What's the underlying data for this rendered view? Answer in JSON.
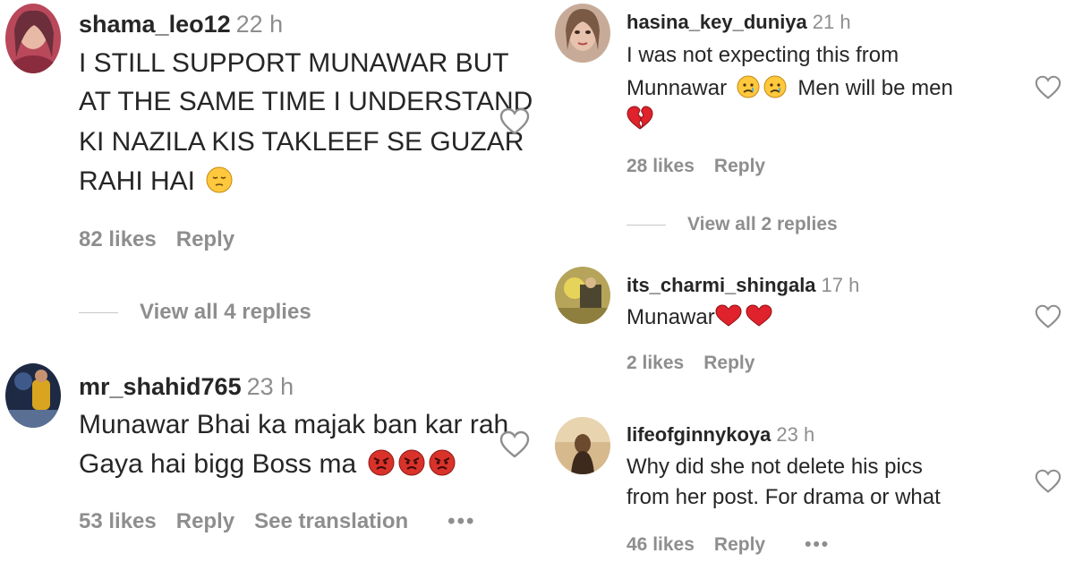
{
  "colors": {
    "text": "#262626",
    "muted": "#8e8e8e",
    "heart_red": "#ed1c24",
    "emoji_yellow": "#ffc83d",
    "emoji_angry": "#d8322a"
  },
  "left_comments": [
    {
      "username": "shama_leo12",
      "time": "22 h",
      "lines": [
        "I STILL SUPPORT MUNAWAR BUT",
        "AT THE SAME TIME I UNDERSTAND",
        "KI NAZILA KIS TAKLEEF SE GUZAR",
        "RAHI HAI"
      ],
      "trailing_emoji": [
        "pensive-face-icon"
      ],
      "likes": "82 likes",
      "reply_label": "Reply",
      "view_replies": "View all 4 replies"
    },
    {
      "username": "mr_shahid765",
      "time": "23 h",
      "lines": [
        "Munawar Bhai ka majak ban kar rah",
        "Gaya hai bigg Boss ma"
      ],
      "trailing_emoji": [
        "angry-face-icon",
        "angry-face-icon",
        "angry-face-icon"
      ],
      "likes": "53 likes",
      "reply_label": "Reply",
      "translation_label": "See translation",
      "more_label": "•••"
    }
  ],
  "right_comments": [
    {
      "username": "hasina_key_duniya",
      "time": "21 h",
      "lines": [
        "I was not expecting this from",
        "Munnawar",
        "Men will be men"
      ],
      "line_emoji": [
        "crying-face-icon",
        "crying-face-icon"
      ],
      "third_line_emoji": "broken-heart-icon",
      "likes": "28 likes",
      "reply_label": "Reply",
      "view_replies": "View all 2 replies"
    },
    {
      "username": "its_charmi_shingala",
      "time": "17 h",
      "lines": [
        "Munawar"
      ],
      "trailing_emoji": [
        "red-heart-icon",
        "red-heart-icon"
      ],
      "likes": "2 likes",
      "reply_label": "Reply"
    },
    {
      "username": "lifeofginnykoya",
      "time": "23 h",
      "lines": [
        "Why did she not delete his pics",
        "from her post. For drama or what"
      ],
      "likes": "46 likes",
      "reply_label": "Reply",
      "more_label": "•••"
    }
  ]
}
